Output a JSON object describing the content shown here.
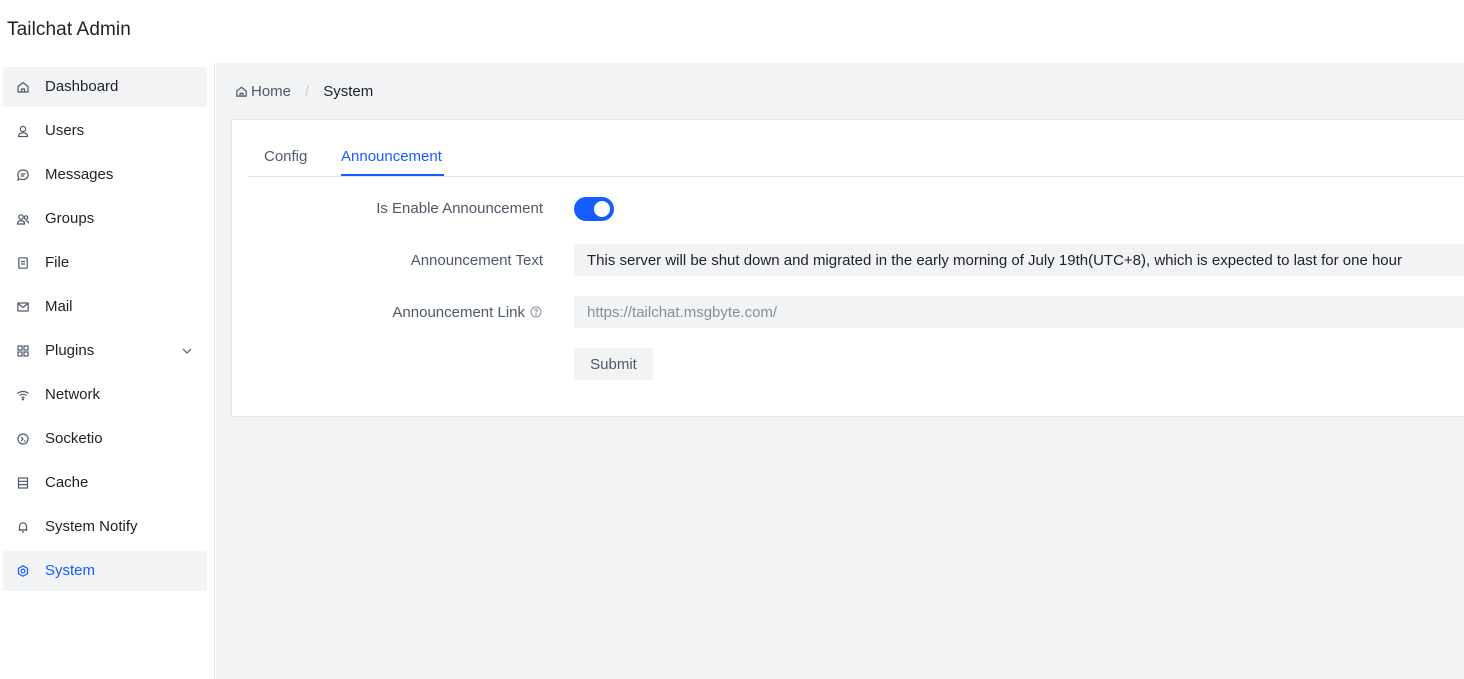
{
  "app": {
    "title": "Tailchat Admin"
  },
  "sidebar": {
    "items": [
      {
        "label": "Dashboard",
        "icon": "home-icon"
      },
      {
        "label": "Users",
        "icon": "user-icon"
      },
      {
        "label": "Messages",
        "icon": "message-icon"
      },
      {
        "label": "Groups",
        "icon": "user-group-icon"
      },
      {
        "label": "File",
        "icon": "file-icon"
      },
      {
        "label": "Mail",
        "icon": "email-icon"
      },
      {
        "label": "Plugins",
        "icon": "apps-icon",
        "expandable": true
      },
      {
        "label": "Network",
        "icon": "wifi-icon"
      },
      {
        "label": "Socketio",
        "icon": "socket-icon"
      },
      {
        "label": "Cache",
        "icon": "storage-icon"
      },
      {
        "label": "System Notify",
        "icon": "notification-icon"
      },
      {
        "label": "System",
        "icon": "settings-icon",
        "active": true
      }
    ]
  },
  "breadcrumb": {
    "home": "Home",
    "current": "System"
  },
  "tabs": [
    {
      "label": "Config"
    },
    {
      "label": "Announcement",
      "active": true
    }
  ],
  "form": {
    "enable_label": "Is Enable Announcement",
    "enable_value": true,
    "text_label": "Announcement Text",
    "text_value": "This server will be shut down and migrated in the early morning of July 19th(UTC+8), which is expected to last for one hour",
    "link_label": "Announcement Link",
    "link_placeholder": "https://tailchat.msgbyte.com/",
    "submit_label": "Submit"
  },
  "colors": {
    "primary": "#165dff",
    "background": "#f2f3f5",
    "text": "#1d2129",
    "secondary_text": "#4e5969"
  }
}
